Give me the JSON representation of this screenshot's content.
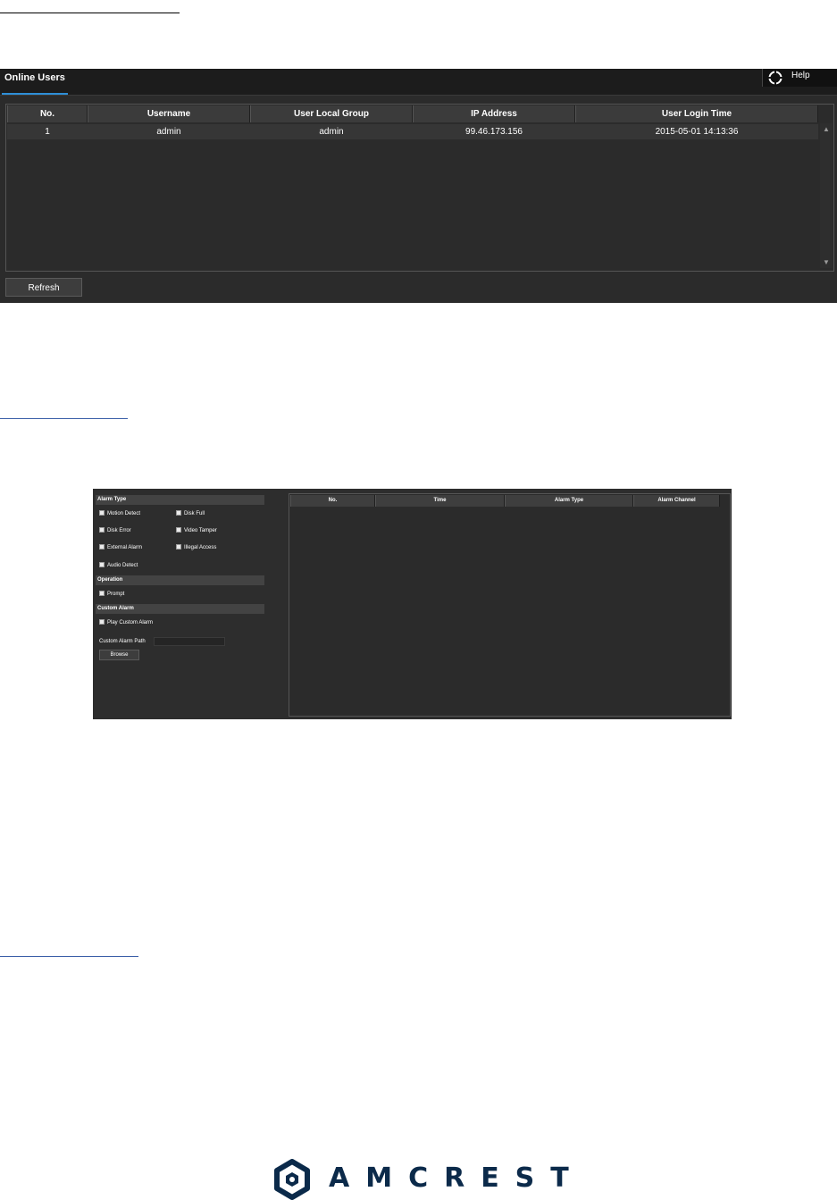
{
  "online_users": {
    "tab_label": "Online Users",
    "help_label": "Help",
    "columns": [
      "No.",
      "Username",
      "User Local Group",
      "IP Address",
      "User Login Time"
    ],
    "rows": [
      {
        "no": "1",
        "username": "admin",
        "group": "admin",
        "ip": "99.46.173.156",
        "login_time": "2015-05-01 14:13:36"
      }
    ],
    "refresh_label": "Refresh"
  },
  "alarm": {
    "section_alarm_type": "Alarm Type",
    "alarm_types": [
      "Motion Detect",
      "Disk Full",
      "Disk Error",
      "Video Tamper",
      "External Alarm",
      "Illegal Access",
      "Audio Detect"
    ],
    "section_operation": "Operation",
    "operation_prompt": "Prompt",
    "section_custom_alarm": "Custom Alarm",
    "play_custom_alarm": "Play Custom Alarm",
    "custom_alarm_path_label": "Custom Alarm Path",
    "browse_label": "Browse",
    "columns": [
      "No.",
      "Time",
      "Alarm Type",
      "Alarm Channel"
    ]
  },
  "footer": {
    "logo_text": "AMCREST"
  },
  "colors": {
    "accent_tab": "#2e8fd8",
    "panel_bg": "#2b2b2b",
    "logo_navy": "#0b2a4a",
    "logo_cyan": "#1ca7d8"
  }
}
